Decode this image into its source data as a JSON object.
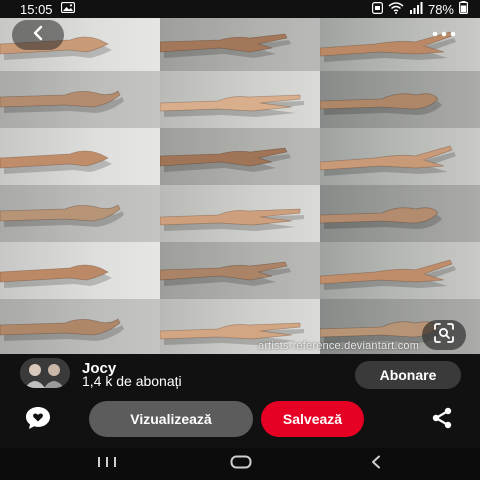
{
  "status_bar": {
    "time": "15:05",
    "battery": "78%",
    "icons": [
      "gallery-notification-icon",
      "screenshot-icon",
      "wifi-icon",
      "signal-icon",
      "battery-icon"
    ]
  },
  "pin": {
    "image_description_icon": "hand-reference-grid",
    "watermark": "artists-reference.deviantart.com",
    "back_icon": "chevron-left-icon",
    "more_icon": "more-horizontal-icon",
    "lens_icon": "visual-search-icon"
  },
  "creator": {
    "name": "Jocy",
    "followers": "1,4 k de abonați",
    "follow_label": "Abonare"
  },
  "actions": {
    "comment_icon": "comment-heart-icon",
    "visit_label": "Vizualizează",
    "save_label": "Salvează",
    "share_icon": "share-icon",
    "save_color": "#e60023"
  },
  "nav": {
    "recents_icon": "recents-icon",
    "home_icon": "home-icon",
    "back_icon": "back-icon"
  }
}
